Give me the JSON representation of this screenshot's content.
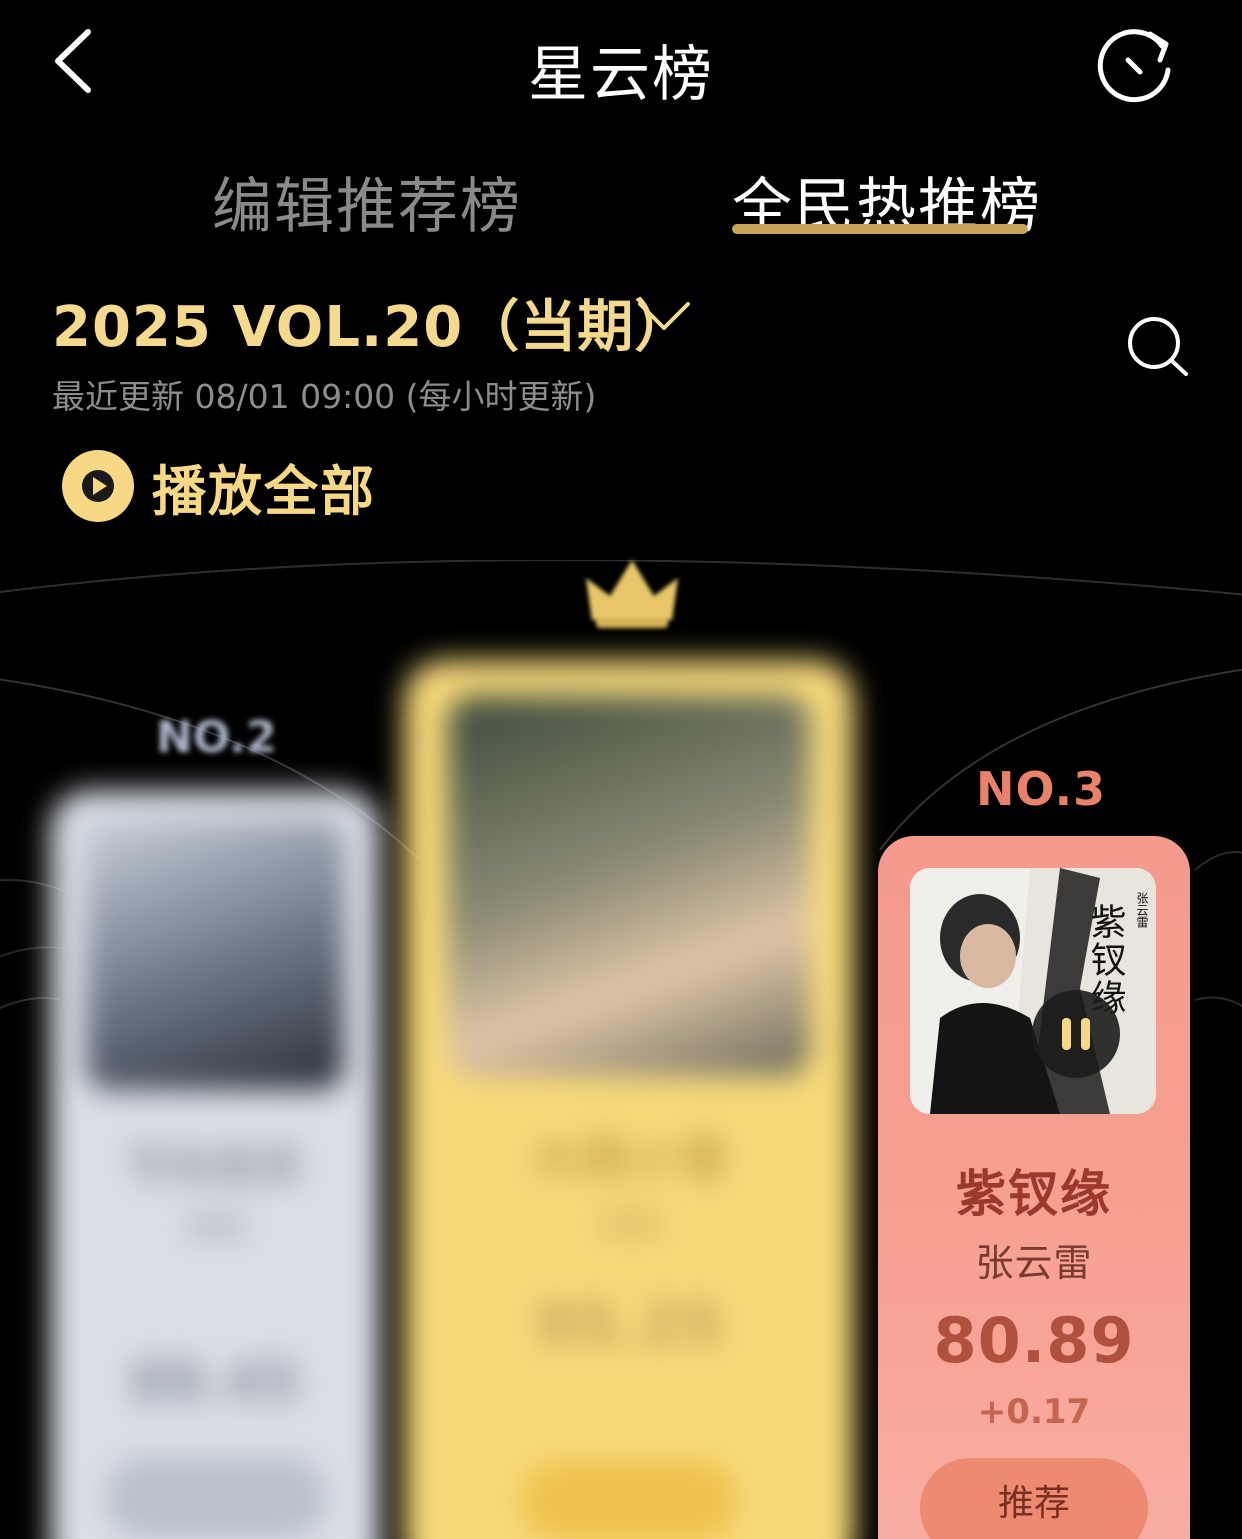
{
  "header": {
    "title": "星云榜",
    "back_icon": "chevron-left-icon",
    "refresh_icon": "refresh-icon"
  },
  "tabs": [
    {
      "label": "编辑推荐榜",
      "active": false
    },
    {
      "label": "全民热推榜",
      "active": true
    }
  ],
  "period": {
    "label": "2025 VOL.20（当期）",
    "update_text": "最近更新 08/01 09:00 (每小时更新)"
  },
  "play_all": {
    "label": "播放全部"
  },
  "ranking": {
    "rank1": {
      "blurred": true,
      "title": "大雨小雪",
      "artist": "未知",
      "score": "95.25",
      "button": "推荐"
    },
    "rank2": {
      "blurred": true,
      "rank_label": "NO.2",
      "title": "写给星辰",
      "artist": "未知",
      "score": "88.45",
      "button": "推荐"
    },
    "rank3": {
      "rank_label": "NO.3",
      "title": "紫钗缘",
      "artist": "张云雷",
      "score": "80.89",
      "delta": "+0.17",
      "button": "推荐",
      "cover_text": "紫钗缘",
      "cover_subtext": "张云雷",
      "playing": true
    }
  },
  "colors": {
    "accent_gold": "#f6d885",
    "tab_underline": "#c9a45a",
    "rank3_card": "#f59a8c",
    "rank3_text": "#9b3a2c"
  }
}
